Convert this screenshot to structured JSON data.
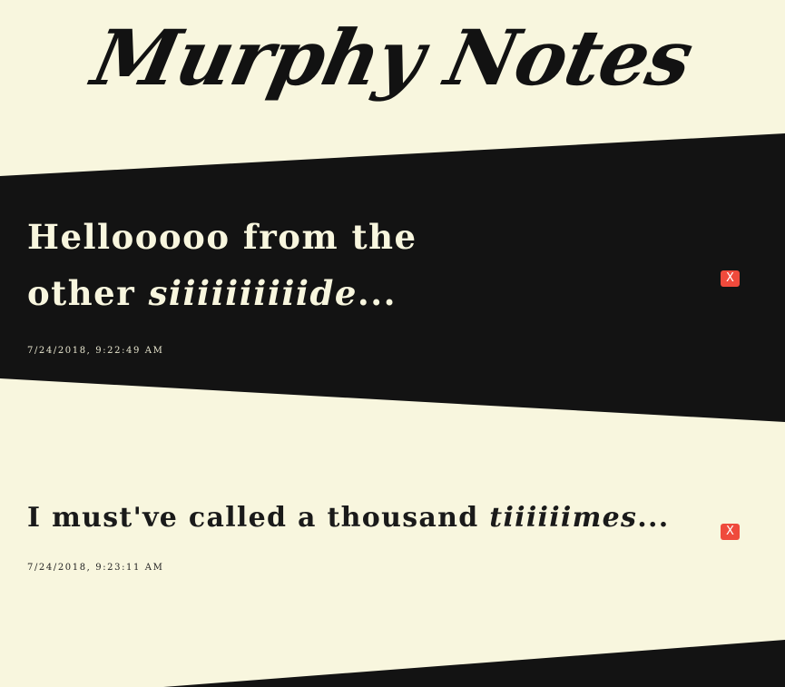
{
  "site": {
    "title": "Murphy Notes"
  },
  "notes": [
    {
      "text_plain": "Hellooooo from the other ",
      "text_emphasis": "siiiiiiiiiide",
      "text_trailing": "...",
      "timestamp": "7/24/2018, 9:22:49 AM",
      "delete_label": "X"
    },
    {
      "text_plain": "I must've called a thousand ",
      "text_emphasis": "tiiiiiimes",
      "text_trailing": "...",
      "timestamp": "7/24/2018, 9:23:11 AM",
      "delete_label": "X"
    }
  ],
  "colors": {
    "background": "#f8f6de",
    "band": "#131313",
    "delete_button": "#ef4a3c"
  }
}
